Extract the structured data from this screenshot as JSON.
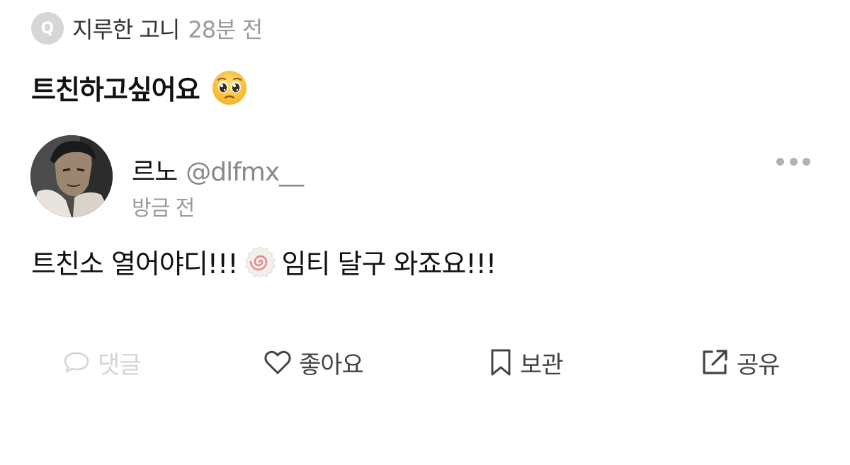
{
  "question": {
    "badge": "Q",
    "author": "지루한 고니",
    "time": "28분 전",
    "text": "트친하고싶어요",
    "emoji": "pleading-face"
  },
  "answer": {
    "name": "르노",
    "handle": "@dlfmx__",
    "time": "방금 전",
    "text_before": "트친소 열어야디!!!",
    "emoji": "fish-cake-with-swirl",
    "text_after": "임티 달구 와죠요!!!"
  },
  "actions": {
    "comment": "댓글",
    "like": "좋아요",
    "save": "보관",
    "share": "공유"
  },
  "colors": {
    "text": "#111111",
    "muted": "#9a9a9a",
    "disabled": "#d4d4d4",
    "badge": "#d6d6d6"
  }
}
